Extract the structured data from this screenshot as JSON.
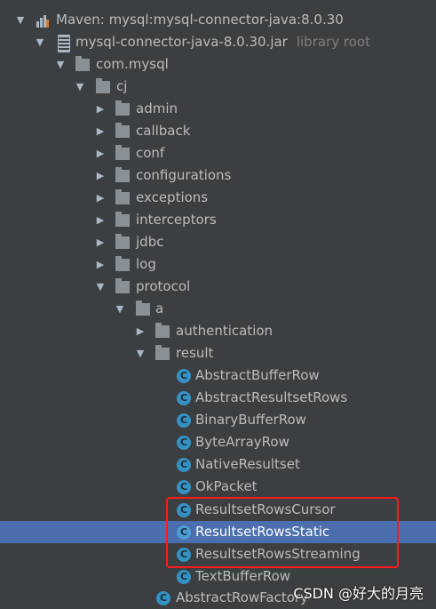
{
  "tree": {
    "maven_lib": "Maven: mysql:mysql-connector-java:8.0.30",
    "jar": "mysql-connector-java-8.0.30.jar",
    "jar_hint": "library root",
    "pkg_com_mysql": "com.mysql",
    "pkg_cj": "cj",
    "folders": [
      "admin",
      "callback",
      "conf",
      "configurations",
      "exceptions",
      "interceptors",
      "jdbc",
      "log",
      "protocol"
    ],
    "pkg_a": "a",
    "folder_authentication": "authentication",
    "folder_result": "result",
    "classes": [
      "AbstractBufferRow",
      "AbstractResultsetRows",
      "BinaryBufferRow",
      "ByteArrayRow",
      "NativeResultset",
      "OkPacket",
      "ResultsetRowsCursor",
      "ResultsetRowsStatic",
      "ResultsetRowsStreaming",
      "TextBufferRow"
    ],
    "after": "AbstractRowFactory",
    "selected": "ResultsetRowsStatic"
  },
  "class_icon_letter": "C",
  "watermark": "CSDN @好大的月亮",
  "colors": {
    "background": "#3c3f41",
    "selection": "#4b6eaf",
    "highlight_box": "#ff1a1a",
    "class_icon": "#3592c4"
  }
}
